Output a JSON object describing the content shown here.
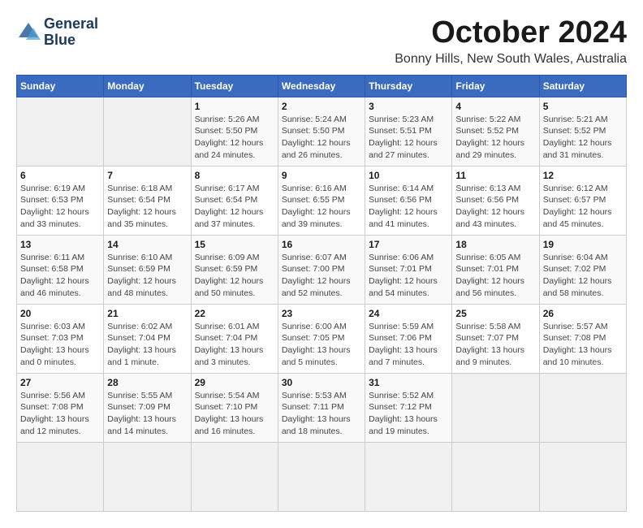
{
  "logo": {
    "line1": "General",
    "line2": "Blue"
  },
  "title": "October 2024",
  "subtitle": "Bonny Hills, New South Wales, Australia",
  "weekdays": [
    "Sunday",
    "Monday",
    "Tuesday",
    "Wednesday",
    "Thursday",
    "Friday",
    "Saturday"
  ],
  "days": [
    {
      "date": "",
      "info": ""
    },
    {
      "date": "",
      "info": ""
    },
    {
      "date": "1",
      "info": "Sunrise: 5:26 AM\nSunset: 5:50 PM\nDaylight: 12 hours and 24 minutes."
    },
    {
      "date": "2",
      "info": "Sunrise: 5:24 AM\nSunset: 5:50 PM\nDaylight: 12 hours and 26 minutes."
    },
    {
      "date": "3",
      "info": "Sunrise: 5:23 AM\nSunset: 5:51 PM\nDaylight: 12 hours and 27 minutes."
    },
    {
      "date": "4",
      "info": "Sunrise: 5:22 AM\nSunset: 5:52 PM\nDaylight: 12 hours and 29 minutes."
    },
    {
      "date": "5",
      "info": "Sunrise: 5:21 AM\nSunset: 5:52 PM\nDaylight: 12 hours and 31 minutes."
    },
    {
      "date": "6",
      "info": "Sunrise: 6:19 AM\nSunset: 6:53 PM\nDaylight: 12 hours and 33 minutes."
    },
    {
      "date": "7",
      "info": "Sunrise: 6:18 AM\nSunset: 6:54 PM\nDaylight: 12 hours and 35 minutes."
    },
    {
      "date": "8",
      "info": "Sunrise: 6:17 AM\nSunset: 6:54 PM\nDaylight: 12 hours and 37 minutes."
    },
    {
      "date": "9",
      "info": "Sunrise: 6:16 AM\nSunset: 6:55 PM\nDaylight: 12 hours and 39 minutes."
    },
    {
      "date": "10",
      "info": "Sunrise: 6:14 AM\nSunset: 6:56 PM\nDaylight: 12 hours and 41 minutes."
    },
    {
      "date": "11",
      "info": "Sunrise: 6:13 AM\nSunset: 6:56 PM\nDaylight: 12 hours and 43 minutes."
    },
    {
      "date": "12",
      "info": "Sunrise: 6:12 AM\nSunset: 6:57 PM\nDaylight: 12 hours and 45 minutes."
    },
    {
      "date": "13",
      "info": "Sunrise: 6:11 AM\nSunset: 6:58 PM\nDaylight: 12 hours and 46 minutes."
    },
    {
      "date": "14",
      "info": "Sunrise: 6:10 AM\nSunset: 6:59 PM\nDaylight: 12 hours and 48 minutes."
    },
    {
      "date": "15",
      "info": "Sunrise: 6:09 AM\nSunset: 6:59 PM\nDaylight: 12 hours and 50 minutes."
    },
    {
      "date": "16",
      "info": "Sunrise: 6:07 AM\nSunset: 7:00 PM\nDaylight: 12 hours and 52 minutes."
    },
    {
      "date": "17",
      "info": "Sunrise: 6:06 AM\nSunset: 7:01 PM\nDaylight: 12 hours and 54 minutes."
    },
    {
      "date": "18",
      "info": "Sunrise: 6:05 AM\nSunset: 7:01 PM\nDaylight: 12 hours and 56 minutes."
    },
    {
      "date": "19",
      "info": "Sunrise: 6:04 AM\nSunset: 7:02 PM\nDaylight: 12 hours and 58 minutes."
    },
    {
      "date": "20",
      "info": "Sunrise: 6:03 AM\nSunset: 7:03 PM\nDaylight: 13 hours and 0 minutes."
    },
    {
      "date": "21",
      "info": "Sunrise: 6:02 AM\nSunset: 7:04 PM\nDaylight: 13 hours and 1 minute."
    },
    {
      "date": "22",
      "info": "Sunrise: 6:01 AM\nSunset: 7:04 PM\nDaylight: 13 hours and 3 minutes."
    },
    {
      "date": "23",
      "info": "Sunrise: 6:00 AM\nSunset: 7:05 PM\nDaylight: 13 hours and 5 minutes."
    },
    {
      "date": "24",
      "info": "Sunrise: 5:59 AM\nSunset: 7:06 PM\nDaylight: 13 hours and 7 minutes."
    },
    {
      "date": "25",
      "info": "Sunrise: 5:58 AM\nSunset: 7:07 PM\nDaylight: 13 hours and 9 minutes."
    },
    {
      "date": "26",
      "info": "Sunrise: 5:57 AM\nSunset: 7:08 PM\nDaylight: 13 hours and 10 minutes."
    },
    {
      "date": "27",
      "info": "Sunrise: 5:56 AM\nSunset: 7:08 PM\nDaylight: 13 hours and 12 minutes."
    },
    {
      "date": "28",
      "info": "Sunrise: 5:55 AM\nSunset: 7:09 PM\nDaylight: 13 hours and 14 minutes."
    },
    {
      "date": "29",
      "info": "Sunrise: 5:54 AM\nSunset: 7:10 PM\nDaylight: 13 hours and 16 minutes."
    },
    {
      "date": "30",
      "info": "Sunrise: 5:53 AM\nSunset: 7:11 PM\nDaylight: 13 hours and 18 minutes."
    },
    {
      "date": "31",
      "info": "Sunrise: 5:52 AM\nSunset: 7:12 PM\nDaylight: 13 hours and 19 minutes."
    },
    {
      "date": "",
      "info": ""
    },
    {
      "date": "",
      "info": ""
    },
    {
      "date": "",
      "info": ""
    },
    {
      "date": "",
      "info": ""
    },
    {
      "date": "",
      "info": ""
    }
  ]
}
